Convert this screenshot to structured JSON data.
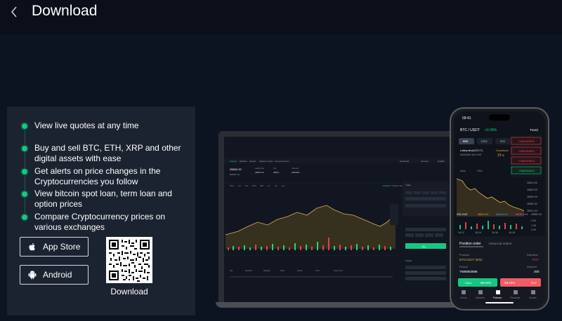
{
  "header": {
    "title": "Download"
  },
  "features": [
    "View live quotes at any time",
    "Buy and sell BTC, ETH, XRP and other digital assets with ease",
    "Get alerts on price changes in the Cryptocurrencies you follow",
    "View bitcoin spot loan, term loan and option prices",
    "Compare Cryptocurrency prices on various exchanges"
  ],
  "downloads": {
    "app_store": "App Store",
    "android": "Android",
    "qr_label": "Download"
  },
  "phone": {
    "time": "09:41",
    "pair": "BTC / USDT",
    "change": "+0.09%",
    "trend": "Trend",
    "tabs": [
      "60s",
      "120s",
      "5mi"
    ],
    "lottery_label": "Lottery time(UTC+7)",
    "lottery_time": "2023/4/20 16:17:00",
    "countdown_label": "Countdown",
    "countdown_value": "23 s",
    "alerts": [
      "Y566663595",
      "Y566663594",
      "Y566663593",
      "Y566663592"
    ],
    "line_label": "Line",
    "vol_label": "VOL",
    "prices": [
      "28612.00",
      "28602.00",
      "28592.00",
      "28582.00",
      "28572.00",
      "28562.00"
    ],
    "ma": [
      "VOL:0.02",
      "MA5:0.02",
      "MA10:0.07",
      "MA30:0.06"
    ],
    "vol_ticks": [
      "2.00",
      "1.00",
      "0.00"
    ],
    "times": [
      "16:12",
      "16:14",
      "16:16",
      "16:18"
    ],
    "position_tab": "Position order",
    "historical_tab": "Historical orders",
    "product_label": "Product",
    "direction_label": "Direction",
    "product_value": "BTCUSDT (60s)",
    "direction_value": "PUT",
    "period_label": "Period",
    "amount_label": "Amount",
    "period_value": "Y566663596",
    "amount_value": "200",
    "call_label": "CALL",
    "call_pct": "96.84%",
    "put_pct": "88.16%",
    "put_label": "PUT",
    "nav": [
      "Home",
      "Markets",
      "Futures",
      "Personal",
      "Assets"
    ]
  },
  "laptop": {
    "nav": [
      "Futures",
      "Markets",
      "Assets",
      "Support center",
      "Announcement"
    ],
    "nav_right": [
      "Download",
      "Account",
      "English"
    ],
    "price": "28834.32",
    "sub_price": "$28834.32",
    "stats": [
      "Last price",
      "Vol",
      "Volume"
    ],
    "stat_values": [
      "28834.32",
      "28612",
      "1984401"
    ],
    "tabs": [
      "Time",
      "1m",
      "5m",
      "15m",
      "30m",
      "1h",
      "1d",
      "1w"
    ],
    "chart_tabs": [
      "Original",
      "Trading View"
    ],
    "order_tabs": [
      "Trade",
      "Open",
      "Closed"
    ],
    "table_headers": [
      "Pair",
      "Direction",
      "Quantity",
      "Price",
      "Result",
      "Time",
      "Close Time"
    ],
    "buy_label": "Buy",
    "assets_label": "Assets"
  }
}
